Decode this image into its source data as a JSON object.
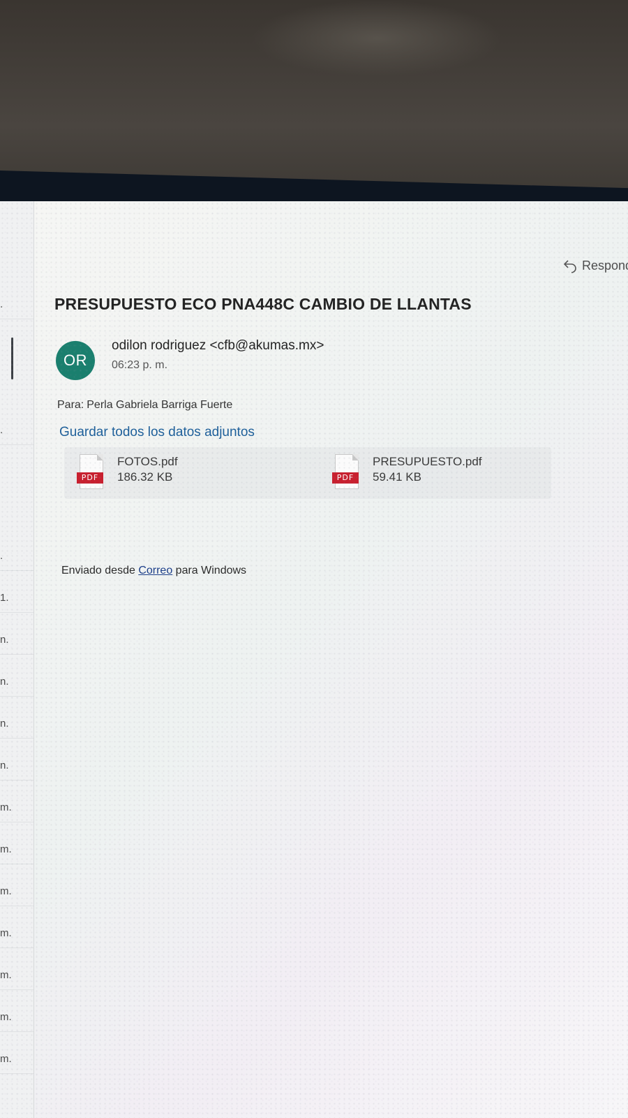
{
  "email": {
    "reply_label": "Respond",
    "subject": "PRESUPUESTO ECO PNA448C CAMBIO DE LLANTAS",
    "avatar_initials": "OR",
    "sender": "odilon rodriguez <cfb@akumas.mx>",
    "time": "06:23 p. m.",
    "to_label": "Para:",
    "to_value": "Perla Gabriela Barriga Fuerte",
    "save_all_label": "Guardar todos los datos adjuntos",
    "attachments": [
      {
        "name": "FOTOS.pdf",
        "size": "186.32 KB",
        "badge": "PDF"
      },
      {
        "name": "PRESUPUESTO.pdf",
        "size": "59.41 KB",
        "badge": "PDF"
      }
    ],
    "signature_prefix": "Enviado desde",
    "signature_link": "Correo",
    "signature_suffix": "para Windows"
  },
  "sidebar": {
    "rows": [
      ".",
      ".",
      ".",
      "1.",
      "n.",
      "n.",
      "n.",
      "n.",
      "m.",
      "m.",
      "m.",
      "m.",
      "m.",
      "m.",
      "m."
    ]
  },
  "colors": {
    "avatar_bg": "#1a7f6e",
    "link": "#1d5f9a",
    "pdf_badge": "#c8202f"
  }
}
